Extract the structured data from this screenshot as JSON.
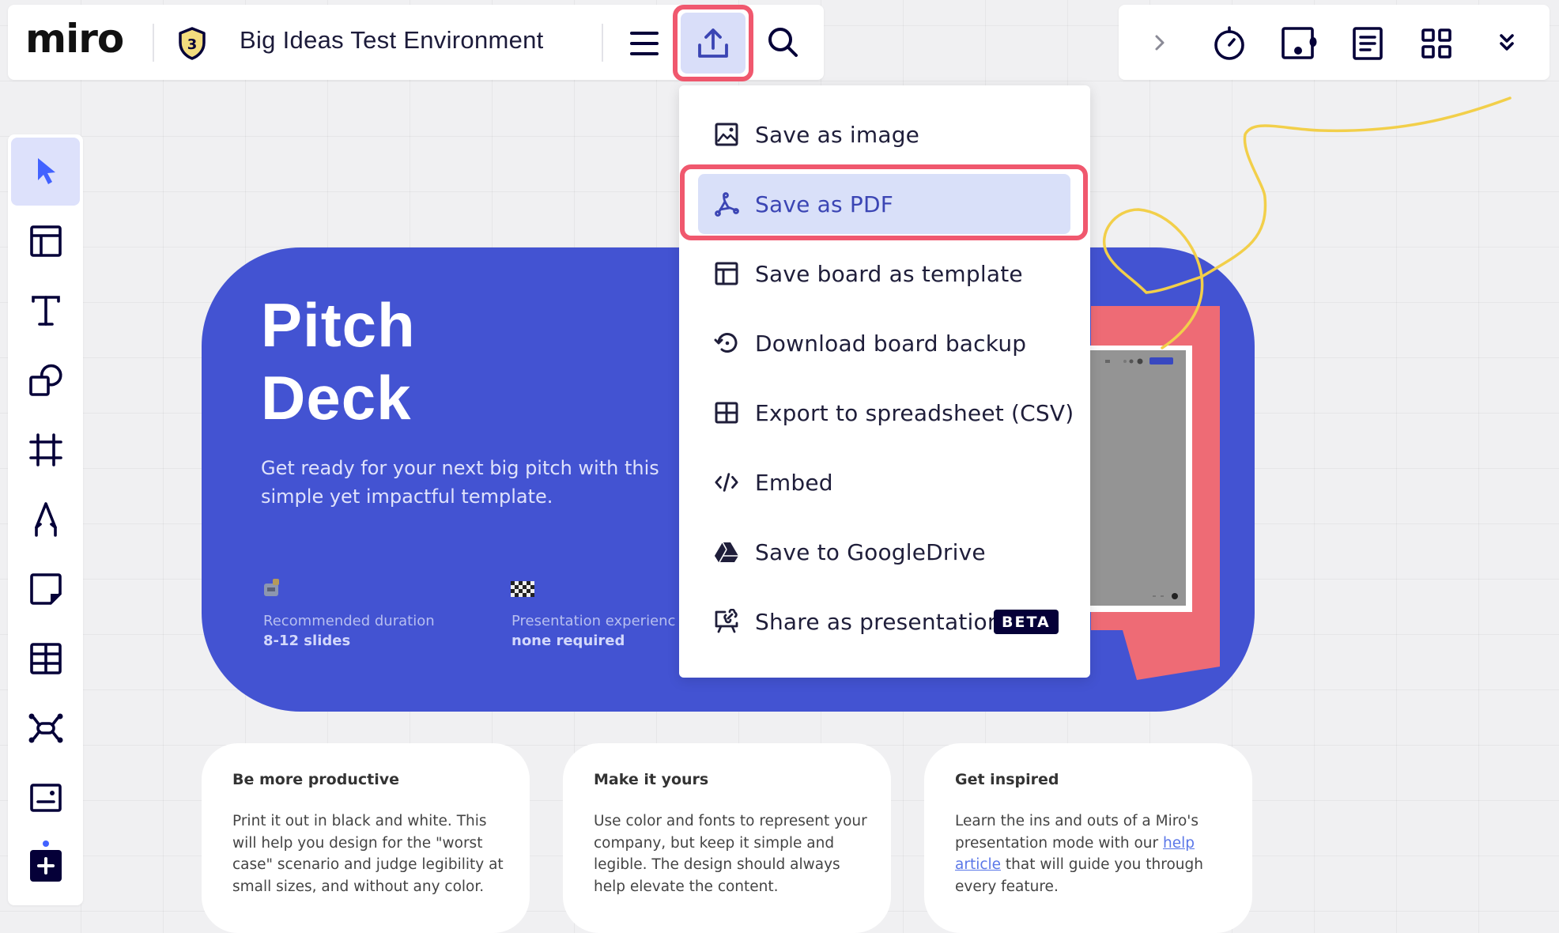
{
  "app": {
    "logo_text": "miro",
    "board_title": "Big Ideas Test Environment",
    "plan_badge_number": "3"
  },
  "topbar_left": {
    "menu_icon": "hamburger-menu-icon",
    "export_icon": "upload-export-icon",
    "search_icon": "search-icon"
  },
  "topbar_right": {
    "icons": [
      "chevron-right-icon",
      "timer-icon",
      "voting-icon",
      "notes-icon",
      "apps-grid-icon",
      "double-chevron-down-icon"
    ]
  },
  "left_toolbar": {
    "tools": [
      {
        "name": "select",
        "icon": "cursor-icon",
        "active": true
      },
      {
        "name": "templates",
        "icon": "template-layout-icon"
      },
      {
        "name": "text",
        "icon": "text-icon"
      },
      {
        "name": "shapes",
        "icon": "shapes-icon"
      },
      {
        "name": "frame",
        "icon": "frame-icon"
      },
      {
        "name": "pen",
        "icon": "pen-icon"
      },
      {
        "name": "sticky-note",
        "icon": "sticky-note-icon"
      },
      {
        "name": "table",
        "icon": "table-icon"
      },
      {
        "name": "mind-map",
        "icon": "mind-map-icon"
      },
      {
        "name": "card",
        "icon": "card-icon"
      },
      {
        "name": "more-apps",
        "icon": "plus-icon"
      }
    ]
  },
  "export_menu": {
    "items": [
      {
        "label": "Save as image",
        "icon": "image-icon"
      },
      {
        "label": "Save as PDF",
        "icon": "pdf-icon",
        "highlighted": true
      },
      {
        "label": "Save board as template",
        "icon": "template-icon"
      },
      {
        "label": "Download board backup",
        "icon": "backup-icon"
      },
      {
        "label": "Export to spreadsheet (CSV)",
        "icon": "spreadsheet-icon"
      },
      {
        "label": "Embed",
        "icon": "code-icon"
      },
      {
        "label": "Save to GoogleDrive",
        "icon": "google-drive-icon"
      },
      {
        "label": "Share as presentation",
        "icon": "presentation-icon",
        "badge": "BETA"
      }
    ]
  },
  "pitch_card": {
    "title_line1": "Pitch",
    "title_line2": "Deck",
    "subtitle": "Get ready for your next big pitch with this simple yet impactful template.",
    "meta": [
      {
        "label": "Recommended duration",
        "value": "8-12 slides"
      },
      {
        "label": "Presentation experienc",
        "value": "none required"
      }
    ]
  },
  "info_cards": [
    {
      "title": "Be more productive",
      "body": "Print it out in black and white. This will help you design for the \"worst case\" scenario and judge legibility at small sizes, and without any color."
    },
    {
      "title": "Make it yours",
      "body": "Use color and fonts to represent your company, but keep it simple and legible. The design should always help elevate the content."
    },
    {
      "title": "Get inspired",
      "body_before": "Learn the ins and outs of a Miro's presentation mode with our ",
      "link_text": "help article",
      "body_after": " that will guide you through every feature."
    }
  ],
  "colors": {
    "accent_blue": "#4353d2",
    "highlight_red": "#f0586e",
    "selection_bg": "#d9e0f9",
    "coral": "#ee6b75",
    "scribble_yellow": "#f2cf4a",
    "ink": "#050038"
  }
}
